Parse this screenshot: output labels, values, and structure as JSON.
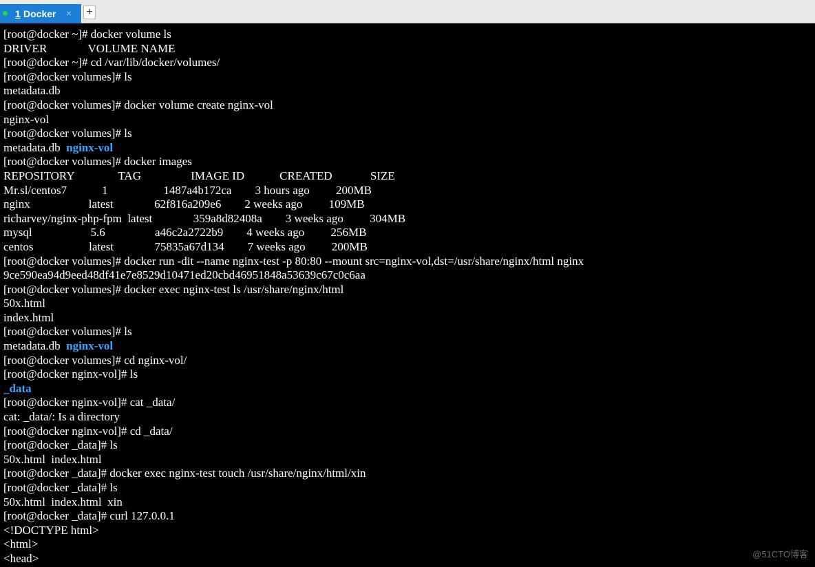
{
  "tab": {
    "number": "1",
    "title": "Docker",
    "close_glyph": "×",
    "status_color": "#2bd14a",
    "accent": "#1c7fd6",
    "new_tab_glyph": "+"
  },
  "terminal": {
    "highlight_color": "#3aa3ff",
    "lines": [
      [
        {
          "t": "[root@docker ~]# docker volume ls"
        }
      ],
      [
        {
          "t": "DRIVER              VOLUME NAME"
        }
      ],
      [
        {
          "t": "[root@docker ~]# cd /var/lib/docker/volumes/"
        }
      ],
      [
        {
          "t": "[root@docker volumes]# ls"
        }
      ],
      [
        {
          "t": "metadata.db"
        }
      ],
      [
        {
          "t": "[root@docker volumes]# docker volume create nginx-vol"
        }
      ],
      [
        {
          "t": "nginx-vol"
        }
      ],
      [
        {
          "t": "[root@docker volumes]# ls"
        }
      ],
      [
        {
          "t": "metadata.db  "
        },
        {
          "t": "nginx-vol",
          "h": true
        }
      ],
      [
        {
          "t": "[root@docker volumes]# docker images"
        }
      ],
      [
        {
          "t": "REPOSITORY               TAG                 IMAGE ID            CREATED             SIZE"
        }
      ],
      [
        {
          "t": "Mr.sl/centos7            1                   1487a4b172ca        3 hours ago         200MB"
        }
      ],
      [
        {
          "t": "nginx                    latest              62f816a209e6        2 weeks ago         109MB"
        }
      ],
      [
        {
          "t": "richarvey/nginx-php-fpm  latest              359a8d82408a        3 weeks ago         304MB"
        }
      ],
      [
        {
          "t": "mysql                    5.6                 a46c2a2722b9        4 weeks ago         256MB"
        }
      ],
      [
        {
          "t": "centos                   latest              75835a67d134        7 weeks ago         200MB"
        }
      ],
      [
        {
          "t": "[root@docker volumes]# docker run -dit --name nginx-test -p 80:80 --mount src=nginx-vol,dst=/usr/share/nginx/html nginx"
        }
      ],
      [
        {
          "t": "9ce590ea94d9eed48df41e7e8529d10471ed20cbd46951848a53639c67c0c6aa"
        }
      ],
      [
        {
          "t": "[root@docker volumes]# docker exec nginx-test ls /usr/share/nginx/html"
        }
      ],
      [
        {
          "t": "50x.html"
        }
      ],
      [
        {
          "t": "index.html"
        }
      ],
      [
        {
          "t": "[root@docker volumes]# ls"
        }
      ],
      [
        {
          "t": "metadata.db  "
        },
        {
          "t": "nginx-vol",
          "h": true
        }
      ],
      [
        {
          "t": "[root@docker volumes]# cd nginx-vol/"
        }
      ],
      [
        {
          "t": "[root@docker nginx-vol]# ls"
        }
      ],
      [
        {
          "t": "_data",
          "h": true
        }
      ],
      [
        {
          "t": "[root@docker nginx-vol]# cat _data/"
        }
      ],
      [
        {
          "t": "cat: _data/: Is a directory"
        }
      ],
      [
        {
          "t": "[root@docker nginx-vol]# cd _data/"
        }
      ],
      [
        {
          "t": "[root@docker _data]# ls"
        }
      ],
      [
        {
          "t": "50x.html  index.html"
        }
      ],
      [
        {
          "t": "[root@docker _data]# docker exec nginx-test touch /usr/share/nginx/html/xin"
        }
      ],
      [
        {
          "t": "[root@docker _data]# ls"
        }
      ],
      [
        {
          "t": "50x.html  index.html  xin"
        }
      ],
      [
        {
          "t": "[root@docker _data]# curl 127.0.0.1"
        }
      ],
      [
        {
          "t": "<!DOCTYPE html>"
        }
      ],
      [
        {
          "t": "<html>"
        }
      ],
      [
        {
          "t": "<head>"
        }
      ]
    ]
  },
  "watermark": "@51CTO博客"
}
